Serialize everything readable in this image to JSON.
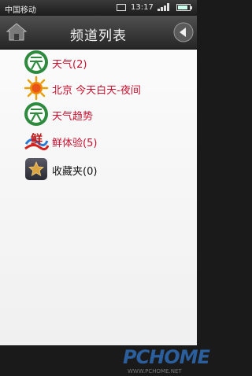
{
  "status_bar": {
    "carrier": "中国移动",
    "time": "13:17"
  },
  "header": {
    "title": "频道列表",
    "home_icon": "home-icon",
    "back_icon": "arrow-left-icon"
  },
  "channels": [
    {
      "label": "天气(2)",
      "icon": "weather-green-icon",
      "color": "#c8102e"
    },
    {
      "label": "北京 今天白天-夜间",
      "icon": "sun-icon",
      "color": "#c8102e"
    },
    {
      "label": "天气趋势",
      "icon": "weather-trend-icon",
      "color": "#c8102e"
    },
    {
      "label": "鲜体验(5)",
      "icon": "fresh-icon",
      "color": "#c8102e"
    },
    {
      "label": "收藏夹(0)",
      "icon": "star-icon",
      "color": "#111111"
    }
  ],
  "watermark": {
    "logo_text": "PCHOME",
    "url": "WWW.PCHOME.NET"
  }
}
